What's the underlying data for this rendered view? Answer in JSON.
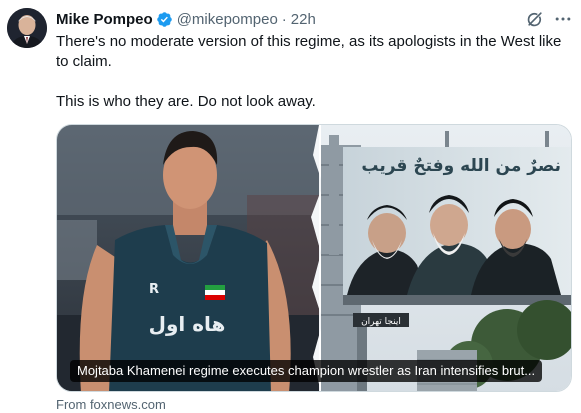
{
  "author": {
    "display_name": "Mike Pompeo",
    "handle": "@mikepompeo",
    "separator": "·",
    "time": "22h",
    "verified_icon": "verified-badge-icon",
    "avatar_icon": "avatar"
  },
  "actions": {
    "grok_icon": "grok-icon",
    "more_icon": "more-options-icon"
  },
  "tweet": {
    "paragraph_1": "There's no moderate version of this regime, as its apologists in the West like to claim.",
    "paragraph_2": "This is who they are. Do not look away."
  },
  "card": {
    "headline": "Mojtaba Khamenei regime executes champion wrestler as Iran intensifies brut...",
    "source": "From foxnews.com",
    "image_description_icon": "news-card-image",
    "singlet_text": "هاه اول",
    "billboard_text": "نصرٌ من الله وفتحٌ قريب",
    "sign_text": "اینجا تهران"
  },
  "colors": {
    "verified_blue": "#1d9bf0",
    "secondary_text": "#536471",
    "primary_text": "#0f1419",
    "border": "#cfd9de"
  }
}
